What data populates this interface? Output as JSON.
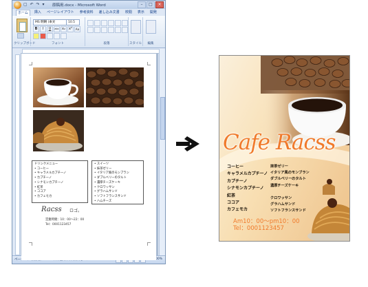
{
  "word_window": {
    "title": "原稿用.docx - Microsoft Word",
    "quick_access": "▢ ↶ ↷ ▾",
    "window_controls": {
      "minimize": "–",
      "maximize": "□",
      "close": "×"
    },
    "tabs": [
      "ホーム",
      "挿入",
      "ページレイアウト",
      "参考資料",
      "差し込み文書",
      "校閲",
      "表示",
      "開発"
    ],
    "font": {
      "name": "MS 明朝 (本文",
      "size": "10.5"
    },
    "format_buttons": [
      "B",
      "I",
      "U",
      "abc",
      "x₂",
      "x²",
      "Aa",
      "A"
    ],
    "ribbon_groups": [
      "クリップボード",
      "フォント",
      "段落",
      "スタイル",
      "編集"
    ],
    "ribbon_right_labels": [
      "スタイル",
      "編集"
    ],
    "document": {
      "list_left": [
        "ドリンクメニュー",
        "コーヒー",
        "キャラメルカプチーノ",
        "カプチーノ",
        "シナモンカプチーノ",
        "紅茶",
        "ココア",
        "カフェモカ"
      ],
      "list_right": [
        "スイーツ",
        "抹茶ゼリー",
        "イタリア風のモンブラン",
        "ダブルベリーのタルト",
        "濃厚チーズケーキ",
        "クロワッサン",
        "グラハムサンド",
        "ソフトフランスサンド",
        "ハムチーズ"
      ],
      "logo_text": "Racss",
      "logo_suffix": "ロゴ。",
      "info_lines": [
        "営業時間：10：00〜22：00",
        "Tel：0001123457"
      ]
    },
    "status_bar": {
      "text": "ページ: 1/1   文字数: 364   ✓  日本語 (日本)   挿入モード",
      "zoom": "100%"
    }
  },
  "arrow": {
    "icon": "right-arrow-icon"
  },
  "flyer": {
    "title": "Cafe Racss",
    "menu_left": [
      "コーヒー",
      "キャラメルカプチーノ",
      "カプチーノ",
      "シナモンカプチーノ",
      "紅茶",
      "ココア",
      "カフェモカ"
    ],
    "menu_right": [
      "抹茶ゼリー",
      "イタリア風のモンブラン",
      "ダブルベリーのタルト",
      "濃厚チーズケーキ",
      "",
      "クロワッサン",
      "グラハムサンド",
      "ソフトフランスサンド"
    ],
    "hours": "Am10：00〜pm10：00",
    "tel": "Tel：0001123457"
  },
  "colors": {
    "accent_orange": "#f07a2b",
    "word_chrome": "#dfe8f5",
    "ribbon_border": "#9fb5d4",
    "coffee_dark": "#3b2314"
  }
}
